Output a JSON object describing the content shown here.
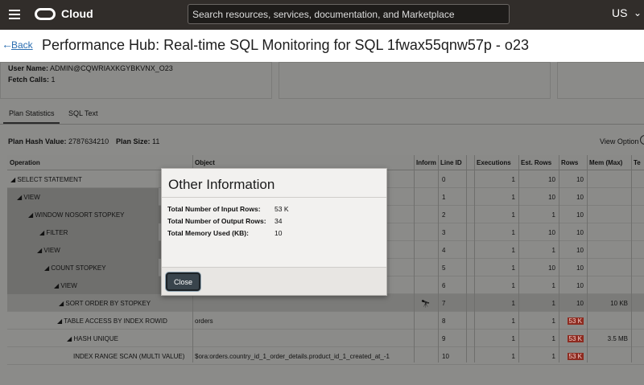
{
  "header": {
    "brand": "Cloud",
    "search_placeholder": "Search resources, services, documentation, and Marketplace",
    "region": "US"
  },
  "titlebar": {
    "back_label": "Back",
    "title": "Performance Hub: Real-time SQL Monitoring for SQL 1fwax55qnw57p - o23"
  },
  "summary": {
    "user_name_label": "User Name:",
    "user_name_value": "ADMIN@CQWRIAXKGYBKVNX_O23",
    "fetch_calls_label": "Fetch Calls:",
    "fetch_calls_value": "1"
  },
  "tabs": [
    "Plan Statistics",
    "SQL Text"
  ],
  "plan": {
    "hash_label": "Plan Hash Value:",
    "hash_value": "2787634210",
    "size_label": "Plan Size:",
    "size_value": "11",
    "view_options": "View Option"
  },
  "table": {
    "columns": [
      "Operation",
      "Object",
      "Inform",
      "Line ID",
      "Executions",
      "Est. Rows",
      "Rows",
      "Mem (Max)",
      "Te"
    ],
    "rows": [
      {
        "op": "◢ SELECT STATEMENT",
        "obj": "",
        "inf": "",
        "line": "0",
        "exe": "1",
        "est": "10",
        "rows": "10",
        "mem": ""
      },
      {
        "op": "◢ VIEW",
        "obj": "",
        "inf": "",
        "line": "1",
        "exe": "1",
        "est": "10",
        "rows": "10",
        "mem": ""
      },
      {
        "op": "◢ WINDOW NOSORT STOPKEY",
        "obj": "",
        "inf": "",
        "line": "2",
        "exe": "1",
        "est": "1",
        "rows": "10",
        "mem": ""
      },
      {
        "op": "◢ FILTER",
        "obj": "",
        "inf": "",
        "line": "3",
        "exe": "1",
        "est": "10",
        "rows": "10",
        "mem": ""
      },
      {
        "op": "◢ VIEW",
        "obj": "",
        "inf": "",
        "line": "4",
        "exe": "1",
        "est": "1",
        "rows": "10",
        "mem": ""
      },
      {
        "op": "◢ COUNT STOPKEY",
        "obj": "",
        "inf": "",
        "line": "5",
        "exe": "1",
        "est": "10",
        "rows": "10",
        "mem": ""
      },
      {
        "op": "◢ VIEW",
        "obj": "",
        "inf": "",
        "line": "6",
        "exe": "1",
        "est": "1",
        "rows": "10",
        "mem": ""
      },
      {
        "op": "◢ SORT ORDER BY STOPKEY",
        "obj": "",
        "inf": "binoculars",
        "line": "7",
        "exe": "1",
        "est": "1",
        "rows": "10",
        "mem": "10 KB"
      },
      {
        "op": "◢ TABLE ACCESS BY INDEX ROWID",
        "obj": "orders",
        "inf": "",
        "line": "8",
        "exe": "1",
        "est": "1",
        "rows": "53 K",
        "mem": ""
      },
      {
        "op": "◢ HASH UNIQUE",
        "obj": "",
        "inf": "",
        "line": "9",
        "exe": "1",
        "est": "1",
        "rows": "53 K",
        "mem": "3.5 MB"
      },
      {
        "op": "INDEX RANGE SCAN (MULTI VALUE)",
        "obj": "$ora:orders.country_id_1_order_details.product_id_1_created_at_-1",
        "inf": "",
        "line": "10",
        "exe": "1",
        "est": "1",
        "rows": "53 K",
        "mem": ""
      }
    ]
  },
  "modal": {
    "title": "Other Information",
    "rows": [
      {
        "label": "Total Number of Input Rows:",
        "value": "53 K"
      },
      {
        "label": "Total Number of Output Rows:",
        "value": "34"
      },
      {
        "label": "Total Memory Used (KB):",
        "value": "10"
      }
    ],
    "close_label": "Close"
  },
  "colors": {
    "topbar": "#312d2a",
    "overlay_bg": "#8b8b89",
    "red_badge": "#8e2b20",
    "link": "#2a6db0"
  }
}
